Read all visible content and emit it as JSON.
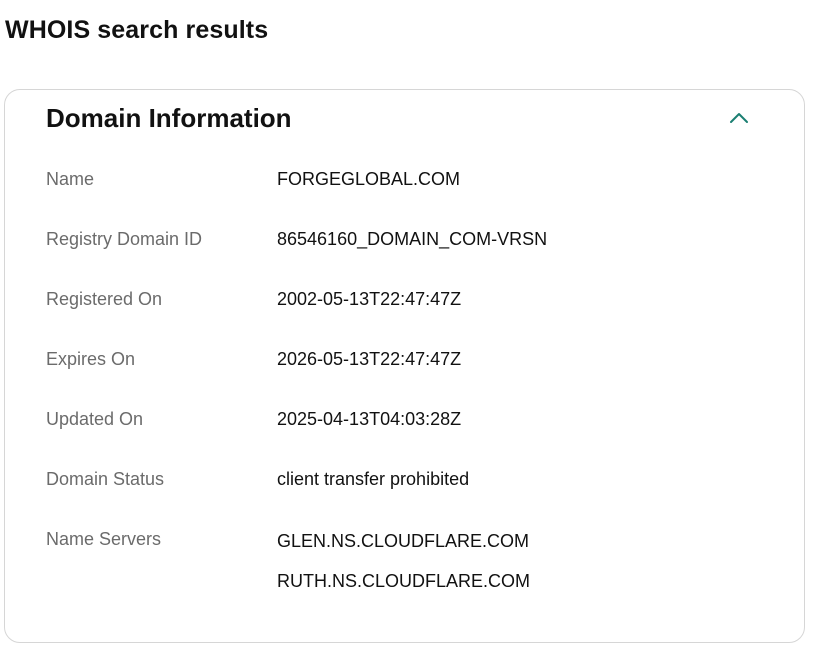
{
  "page": {
    "title": "WHOIS search results"
  },
  "card": {
    "title": "Domain Information",
    "toggle_icon": "chevron-up-icon",
    "accent_color": "#1b7f72"
  },
  "fields": {
    "name": {
      "label": "Name",
      "value": "FORGEGLOBAL.COM"
    },
    "registry_domain_id": {
      "label": "Registry Domain ID",
      "value": "86546160_DOMAIN_COM-VRSN"
    },
    "registered_on": {
      "label": "Registered On",
      "value": "2002-05-13T22:47:47Z"
    },
    "expires_on": {
      "label": "Expires On",
      "value": "2026-05-13T22:47:47Z"
    },
    "updated_on": {
      "label": "Updated On",
      "value": "2025-04-13T04:03:28Z"
    },
    "domain_status": {
      "label": "Domain Status",
      "value": "client transfer prohibited"
    },
    "name_servers": {
      "label": "Name Servers",
      "values": [
        "GLEN.NS.CLOUDFLARE.COM",
        "RUTH.NS.CLOUDFLARE.COM"
      ]
    }
  }
}
